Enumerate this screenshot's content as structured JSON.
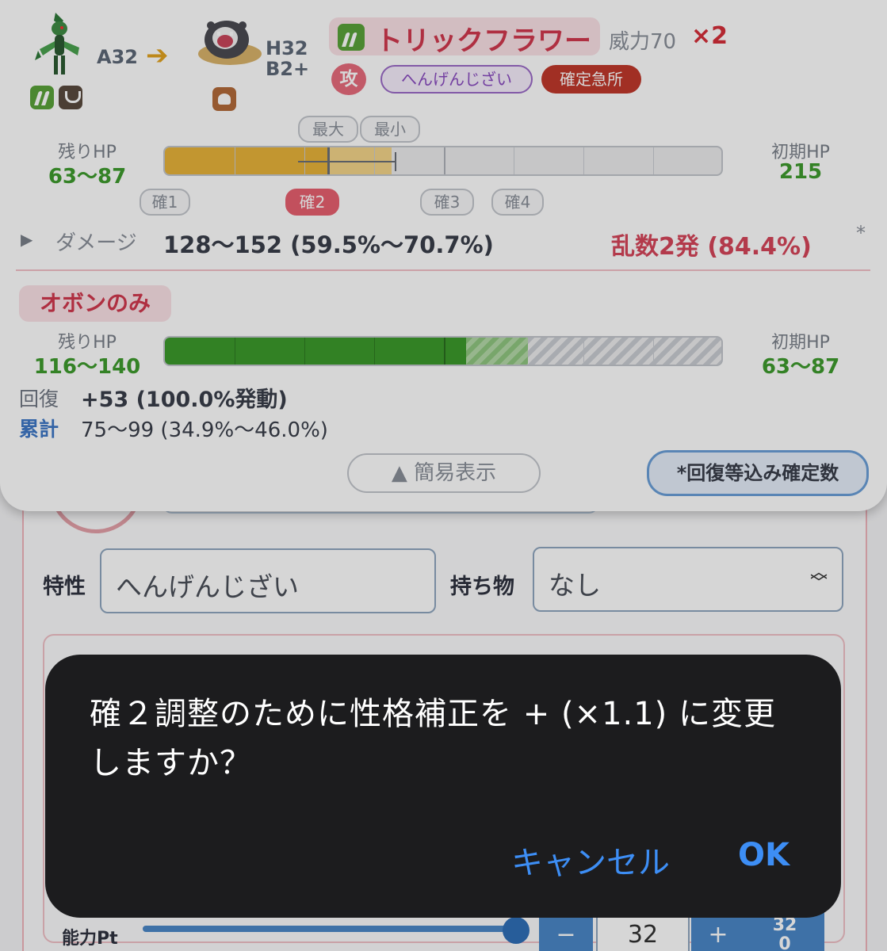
{
  "attacker": {
    "stat": "A32",
    "types": [
      "grass",
      "dark"
    ]
  },
  "defender": {
    "stat_h": "H32",
    "stat_b": "B2+",
    "types": [
      "ground"
    ]
  },
  "move": {
    "name": "トリックフラワー",
    "power": "威力70",
    "multiplier": "×2"
  },
  "chips": {
    "category": "攻",
    "ability": "へんげんじざい",
    "crit": "確定急所"
  },
  "hp_section": {
    "remaining_label": "残りHP",
    "remaining_value": "63〜87",
    "initial_label": "初期HP",
    "initial_value": "215",
    "marker_max": "最大",
    "marker_min": "最小",
    "ko_tags": [
      "確1",
      "確2",
      "確3",
      "確4"
    ],
    "active_ko_tag": "確2",
    "colors": {
      "damage_fill": "#e8b33a",
      "damage_range": "#f4d48a"
    }
  },
  "damage": {
    "label": "ダメージ",
    "value": "128〜152 (59.5%〜70.7%)",
    "ko_chance": "乱数2発 (84.4%)",
    "star": "*"
  },
  "berry": {
    "name": "オボンのみ",
    "remaining_label": "残りHP",
    "remaining_value": "116〜140",
    "initial_label": "初期HP",
    "initial_value": "63〜87",
    "recovery_label": "回復",
    "recovery_value": "+53 (100.0%発動)",
    "total_label": "累計",
    "total_value": "75〜99 (34.9%〜46.0%)",
    "colors": {
      "hp_fill": "#3c9a2c"
    }
  },
  "buttons": {
    "simple_view": "▲ 簡易表示",
    "note": "*回復等込み確定数"
  },
  "form": {
    "ability_label": "特性",
    "ability_value": "へんげんじざい",
    "item_label": "持ち物",
    "item_value": "なし",
    "ability_points_label": "能力Pt",
    "stepper_value": "32",
    "stepper_minus": "−",
    "stepper_plus": "+",
    "stepper_max_top": "32",
    "stepper_max_bottom": "0"
  },
  "dialog": {
    "message": "確２調整のために性格補正を + (×1.1) に変更しますか？",
    "cancel_label": "キャンセル",
    "ok_label": "OK"
  }
}
